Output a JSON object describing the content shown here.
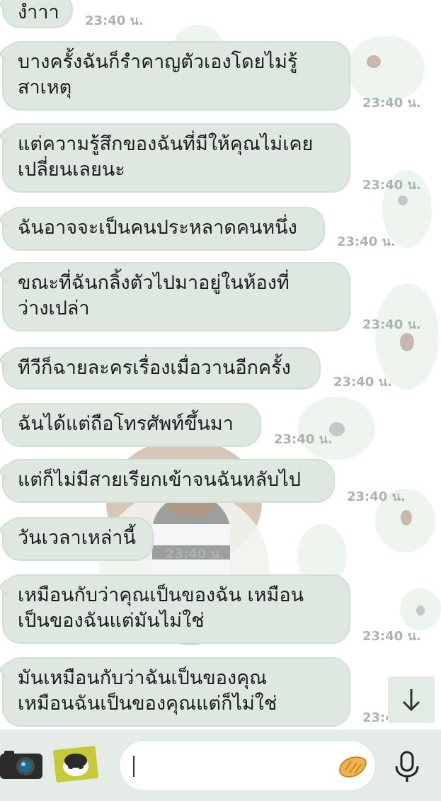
{
  "messages": [
    {
      "text": "งำาา",
      "time": "23:40 น."
    },
    {
      "text": "บางครั้งฉันก็รำคาญตัวเองโดยไม่รู้\nสาเหตุ",
      "time": "23:40 น."
    },
    {
      "text": "แต่ความรู้สึกของฉันที่มีให้คุณไม่เคย\nเปลี่ยนเลยนะ",
      "time": "23:40 น."
    },
    {
      "text": "ฉันอาจจะเป็นคนประหลาดคนหนึ่ง",
      "time": "23:40 น."
    },
    {
      "text": "ขณะที่ฉันกลิ้งตัวไปมาอยู่ในห้องที่\nว่างเปล่า",
      "time": "23:40 น."
    },
    {
      "text": "ทีวีก็ฉายละครเรื่องเมื่อวานอีกครั้ง",
      "time": "23:40 น."
    },
    {
      "text": "ฉันได้แต่ถือโทรศัพท์ขึ้นมา",
      "time": "23:40 น."
    },
    {
      "text": "แต่ก็ไม่มีสายเรียกเข้าจนฉันหลับไป",
      "time": "23:40 น."
    },
    {
      "text": "วันเวลาเหล่านี้",
      "time": "23:40 น."
    },
    {
      "text": "เหมือนกับว่าคุณเป็นของฉัน เหมือน\nเป็นของฉันแต่มันไม่ใช่",
      "time": "23:40 น."
    },
    {
      "text": "มันเหมือนกับว่าฉันเป็นของคุณ\nเหมือนฉันเป็นของคุณแต่ก็ไม่ใช่",
      "time": "23:40 น."
    }
  ],
  "input": {
    "value": "",
    "placeholder": ""
  },
  "icons": {
    "camera": "camera-icon",
    "sticker": "sticker-icon",
    "emoji": "emoji-icon",
    "mic": "microphone-icon",
    "scroll": "arrow-down-icon"
  },
  "colors": {
    "bubble": "#dfe7e1",
    "bubble_border": "#cfe0d3",
    "time": "#a9b5ae",
    "bar": "#e5ece7"
  }
}
